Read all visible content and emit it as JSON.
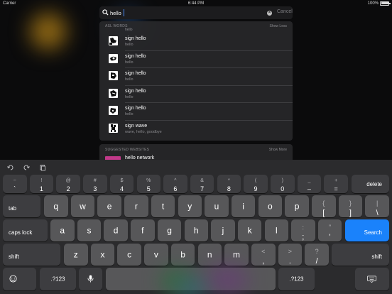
{
  "status_bar": {
    "carrier": "Carrier",
    "time": "6:44 PM",
    "battery": "100%"
  },
  "search": {
    "query": "hello",
    "cancel_label": "Cancel"
  },
  "results": {
    "section_title": "ASL WORDS",
    "toggle_label": "Show Less",
    "clipped_row_sub": "hello",
    "items": [
      {
        "title": "sign hello",
        "subtitle": "hello"
      },
      {
        "title": "sign hello",
        "subtitle": "hello"
      },
      {
        "title": "sign hello",
        "subtitle": "hello"
      },
      {
        "title": "sign hello",
        "subtitle": "hello"
      },
      {
        "title": "sign hello",
        "subtitle": "hello"
      },
      {
        "title": "sign wave",
        "subtitle": "wave, hello, goodbye"
      }
    ]
  },
  "suggested": {
    "section_title": "SUGGESTED WEBSITES",
    "toggle_label": "Show More",
    "item_title": "hello network"
  },
  "keyboard": {
    "row1": [
      {
        "top": "~",
        "bottom": "`"
      },
      {
        "top": "!",
        "bottom": "1"
      },
      {
        "top": "@",
        "bottom": "2"
      },
      {
        "top": "#",
        "bottom": "3"
      },
      {
        "top": "$",
        "bottom": "4"
      },
      {
        "top": "%",
        "bottom": "5"
      },
      {
        "top": "^",
        "bottom": "6"
      },
      {
        "top": "&",
        "bottom": "7"
      },
      {
        "top": "*",
        "bottom": "8"
      },
      {
        "top": "(",
        "bottom": "9"
      },
      {
        "top": ")",
        "bottom": "0"
      },
      {
        "top": "_",
        "bottom": "–"
      },
      {
        "top": "+",
        "bottom": "="
      }
    ],
    "delete": "delete",
    "tab": "tab",
    "row2": [
      "q",
      "w",
      "e",
      "r",
      "t",
      "y",
      "u",
      "i",
      "o",
      "p"
    ],
    "row2_sym": [
      {
        "top": "{",
        "bottom": "["
      },
      {
        "top": "}",
        "bottom": "]"
      },
      {
        "top": "|",
        "bottom": "\\"
      }
    ],
    "caps": "caps lock",
    "row3": [
      "a",
      "s",
      "d",
      "f",
      "g",
      "h",
      "j",
      "k",
      "l"
    ],
    "row3_sym": [
      {
        "top": ":",
        "bottom": ";"
      },
      {
        "top": "”",
        "bottom": "’"
      }
    ],
    "search": "Search",
    "shift": "shift",
    "row4": [
      "z",
      "x",
      "c",
      "v",
      "b",
      "n",
      "m"
    ],
    "row4_sym": [
      {
        "top": "<",
        "bottom": ","
      },
      {
        "top": ">",
        "bottom": "."
      },
      {
        "top": "?",
        "bottom": "/"
      }
    ],
    "numbers": ".?123"
  }
}
